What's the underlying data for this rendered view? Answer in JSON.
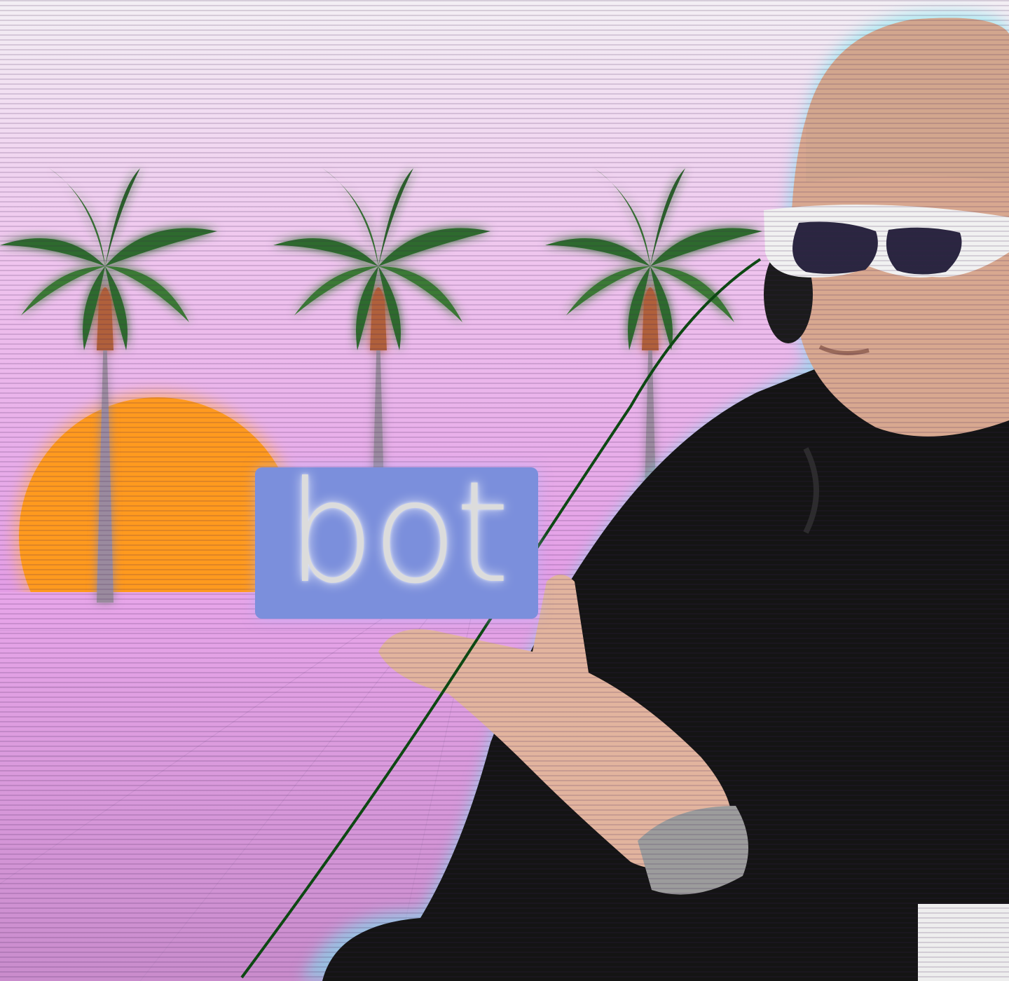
{
  "meme": {
    "caption": "bot",
    "palette": {
      "sky_top": "#f2eef4",
      "sky_bottom": "#e6a2e8",
      "floor": "#d88ed8",
      "sun": "#ff9a1e",
      "sun_glow": "#ffb060",
      "palm_glow": "#ff8ff0",
      "caption_bg": "#7b8fdc",
      "caption_text": "#dcdcdc",
      "person_outline": "#6fe8f0",
      "wire": "#0b4a10"
    },
    "scene_elements": [
      "palm-tree-icon",
      "sunset-icon",
      "grid-floor",
      "person-with-sunglasses",
      "earphone-wire"
    ]
  }
}
